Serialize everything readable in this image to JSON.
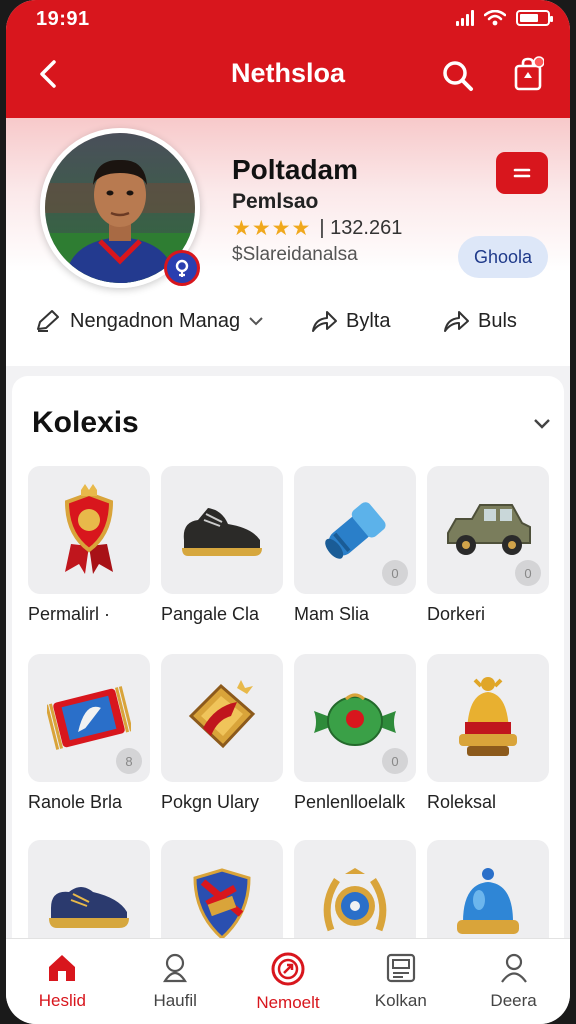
{
  "status": {
    "time": "19:91"
  },
  "header": {
    "title": "Nethsloa"
  },
  "profile": {
    "name": "Poltadam",
    "subtitle": "Pemlsao",
    "stars": "★★★★",
    "rating_count": "| 132.261",
    "meta": "$Slareidanalsa",
    "follow_label": "Ghoola",
    "actions": [
      {
        "label": "Nengadnon Manag",
        "icon": "edit-icon"
      },
      {
        "label": "Bylta",
        "icon": "share-icon"
      },
      {
        "label": "Buls",
        "icon": "share-icon"
      }
    ]
  },
  "collection": {
    "title": "Kolexis",
    "items": [
      {
        "label": "Permalirl ·",
        "icon": "shield-medal-icon",
        "badge": ""
      },
      {
        "label": "Pangale Cla",
        "icon": "boot-icon",
        "badge": ""
      },
      {
        "label": "Mam Slia",
        "icon": "blue-pipe-icon",
        "badge": "0"
      },
      {
        "label": "Dorkeri",
        "icon": "jeep-icon",
        "badge": "0"
      },
      {
        "label": "Ranole Brla",
        "icon": "scarf-icon",
        "badge": "8"
      },
      {
        "label": "Pokgn Ulary",
        "icon": "pennant-icon",
        "badge": ""
      },
      {
        "label": "Penlenlloelalk",
        "icon": "candy-icon",
        "badge": "0"
      },
      {
        "label": "Roleksal",
        "icon": "bell-icon",
        "badge": ""
      },
      {
        "label": "",
        "icon": "shoe-icon",
        "badge": ""
      },
      {
        "label": "",
        "icon": "crest-icon",
        "badge": ""
      },
      {
        "label": "",
        "icon": "laurel-emblem-icon",
        "badge": ""
      },
      {
        "label": "",
        "icon": "blue-dome-icon",
        "badge": ""
      }
    ]
  },
  "nav": [
    {
      "label": "Heslid",
      "icon": "home-icon",
      "active": true
    },
    {
      "label": "Haufil",
      "icon": "profile-pin-icon",
      "active": false
    },
    {
      "label": "Nemoelt",
      "icon": "target-icon",
      "active": false
    },
    {
      "label": "Kolkan",
      "icon": "card-icon",
      "active": false
    },
    {
      "label": "Deera",
      "icon": "user-icon",
      "active": false
    }
  ],
  "colors": {
    "brand": "#d8161d",
    "star": "#f0a81c",
    "follow_bg": "#dde7f8"
  }
}
